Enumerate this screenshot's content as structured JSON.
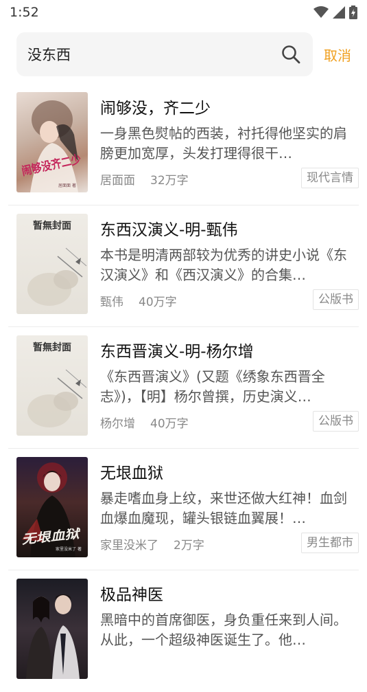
{
  "status": {
    "time": "1:52"
  },
  "search": {
    "query": "没东西",
    "cancel": "取消"
  },
  "books": [
    {
      "title": "闹够没，齐二少",
      "desc": "一身黑色熨帖的西装，衬托得他坚实的肩膀更加宽厚，头发打理得很干…",
      "author": "居面面",
      "words": "32万字",
      "tag": "现代言情",
      "cover_text": "闹够没齐二少",
      "cover_sub": "居面面 著"
    },
    {
      "title": "东西汉演义-明-甄伟",
      "desc": "本书是明清两部较为优秀的讲史小说《东汉演义》和《西汉演义》的合集…",
      "author": "甄伟",
      "words": "40万字",
      "tag": "公版书",
      "cover_text": "暂無封面"
    },
    {
      "title": "东西晋演义-明-杨尔增",
      "desc": "《东西晋演义》(又题《绣象东西晋全志》)，【明】杨尔曾撰，历史演义…",
      "author": "杨尔增",
      "words": "40万字",
      "tag": "公版书",
      "cover_text": "暂無封面"
    },
    {
      "title": "无垠血狱",
      "desc": "暴走嗜血身上纹，来世还做大红神！血剑血爆血魔现，罐头银链血翼展！…",
      "author": "家里没米了",
      "words": "2万字",
      "tag": "男生都市",
      "cover_text": "无垠血狱",
      "cover_sub": "家里没米了 著"
    },
    {
      "title": "极品神医",
      "desc": "黑暗中的首席御医，身负重任来到人间。从此，一个超级神医诞生了。他…",
      "author": "",
      "words": "",
      "tag": ""
    }
  ]
}
